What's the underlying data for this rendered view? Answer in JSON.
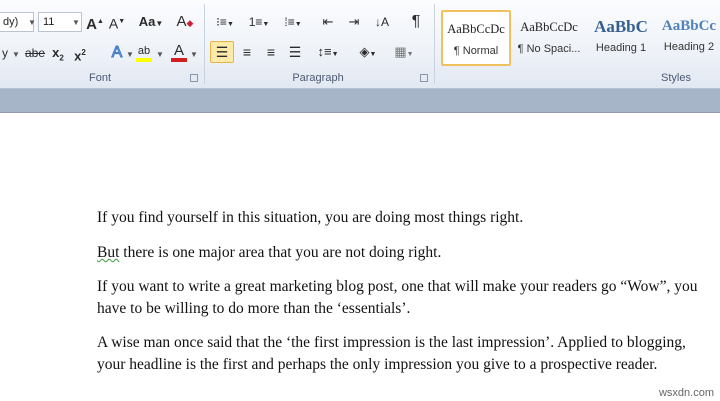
{
  "font_group": {
    "font_name_fragment": "dy)",
    "font_size": "11",
    "grow_font": "A",
    "shrink_font": "A",
    "change_case": "Aa",
    "bold_partial": "y",
    "strikethrough": "abe",
    "subscript": "x",
    "superscript": "x",
    "text_effects": "A",
    "highlight": "ab",
    "font_color": "A",
    "label": "Font"
  },
  "paragraph_group": {
    "pilcrow": "¶",
    "label": "Paragraph"
  },
  "styles_group": {
    "styles": [
      {
        "preview": "AaBbCcDc",
        "name": "¶ Normal"
      },
      {
        "preview": "AaBbCcDc",
        "name": "¶ No Spaci..."
      },
      {
        "preview": "AaBbC",
        "name": "Heading 1"
      },
      {
        "preview": "AaBbCc",
        "name": "Heading 2"
      }
    ],
    "label": "Styles"
  },
  "document": {
    "paragraphs": [
      {
        "lines": [
          "If you find yourself in this situation, you are doing most things right."
        ]
      },
      {
        "first_word": "But",
        "rest": " there is one major area that you are not doing right."
      },
      {
        "lines": [
          "If you want to write a great marketing blog post, one that will make your readers go “Wow”, you",
          "have to be willing to do more than the ‘essentials’."
        ]
      },
      {
        "lines": [
          "A wise man once said that the ‘the first impression is the last impression’.  Applied to blogging,",
          "your headline is the first and perhaps the only impression  you give to a prospective reader."
        ]
      }
    ]
  },
  "watermark": "wsxdn.com",
  "colors": {
    "highlight": "#ffff00",
    "font_color": "#d11f1f",
    "active_button": "#fde9a8"
  }
}
